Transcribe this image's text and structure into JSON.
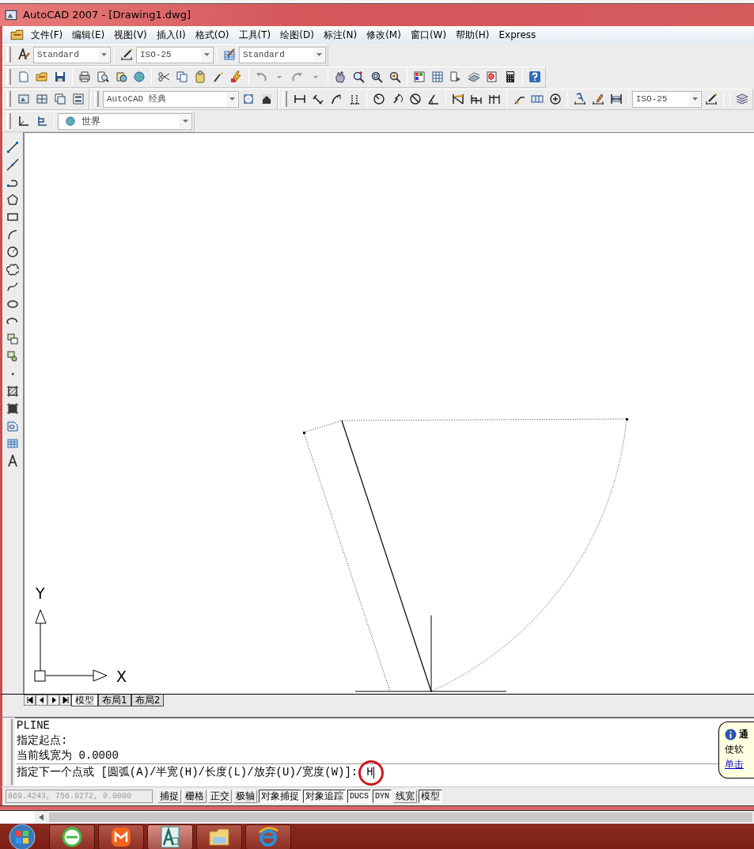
{
  "window": {
    "title": "AutoCAD 2007 - [Drawing1.dwg]"
  },
  "menu": [
    {
      "label": "文件(F)"
    },
    {
      "label": "编辑(E)"
    },
    {
      "label": "视图(V)"
    },
    {
      "label": "插入(I)"
    },
    {
      "label": "格式(O)"
    },
    {
      "label": "工具(T)"
    },
    {
      "label": "绘图(D)"
    },
    {
      "label": "标注(N)"
    },
    {
      "label": "修改(M)"
    },
    {
      "label": "窗口(W)"
    },
    {
      "label": "帮助(H)"
    },
    {
      "label": "Express"
    }
  ],
  "toolbars": {
    "text_style": "Standard",
    "dim_style": "ISO-25",
    "table_style": "Standard",
    "workspace": "AutoCAD 经典",
    "dim_style_2": "ISO-25",
    "ucs": "世界"
  },
  "ucs_icon": {
    "y_label": "Y",
    "x_label": "X"
  },
  "layout_tabs": [
    {
      "label": "模型",
      "selected": true
    },
    {
      "label": "布局1",
      "selected": false
    },
    {
      "label": "布局2",
      "selected": false
    }
  ],
  "command_history": [
    "PLINE",
    "指定起点:",
    "当前线宽为 0.0000"
  ],
  "command_prompt": {
    "text": "指定下一个点或 [圆弧(A)/半宽(H)/长度(L)/放弃(U)/宽度(W)]:",
    "value": "H"
  },
  "notification": {
    "title": "通",
    "body": "使软",
    "link": "单击"
  },
  "status_bar": {
    "coordinates": "869.4243, 756.9272, 0.0000",
    "toggles": [
      {
        "label": "捕捉",
        "on": false
      },
      {
        "label": "栅格",
        "on": false
      },
      {
        "label": "正交",
        "on": false
      },
      {
        "label": "极轴",
        "on": false
      },
      {
        "label": "对象捕捉",
        "on": true
      },
      {
        "label": "对象追踪",
        "on": true
      },
      {
        "label": "DUCS",
        "on": true
      },
      {
        "label": "DYN",
        "on": true
      },
      {
        "label": "线宽",
        "on": false
      },
      {
        "label": "模型",
        "on": true
      }
    ]
  }
}
